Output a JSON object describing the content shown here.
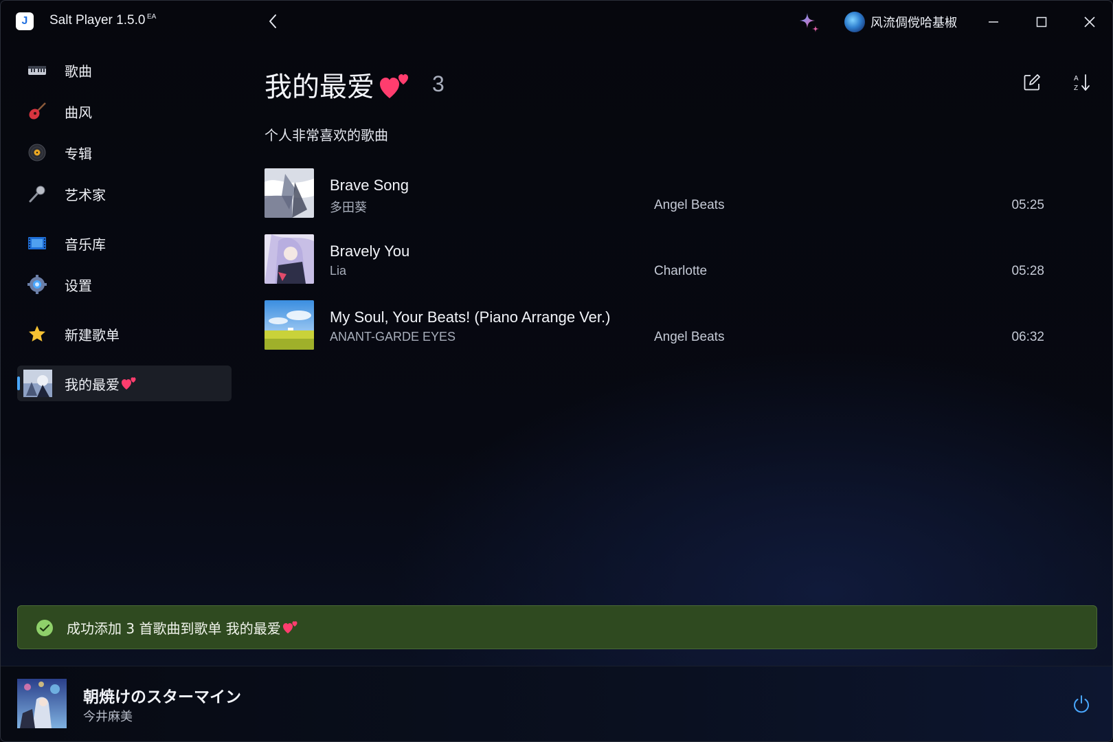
{
  "window": {
    "app_name": "Salt Player 1.5.0",
    "app_badge": "EA",
    "logo_letter": "J",
    "user_name": "风流倜傥哈基椒"
  },
  "sidebar": {
    "items": [
      {
        "label": "歌曲",
        "icon": "piano-icon"
      },
      {
        "label": "曲风",
        "icon": "guitar-icon"
      },
      {
        "label": "专辑",
        "icon": "vinyl-icon"
      },
      {
        "label": "艺术家",
        "icon": "microphone-icon"
      },
      {
        "label": "音乐库",
        "icon": "film-strip-icon"
      },
      {
        "label": "设置",
        "icon": "gear-icon"
      },
      {
        "label": "新建歌单",
        "icon": "star-icon"
      },
      {
        "label": "我的最爱",
        "icon": "playlist-cover-icon",
        "active": true
      }
    ]
  },
  "playlist": {
    "title": "我的最爱",
    "count": "3",
    "description": "个人非常喜欢的歌曲",
    "songs": [
      {
        "title": "Brave Song",
        "artist": "多田葵",
        "album": "Angel Beats",
        "duration": "05:25"
      },
      {
        "title": "Bravely You",
        "artist": "Lia",
        "album": "Charlotte",
        "duration": "05:28"
      },
      {
        "title": "My Soul, Your Beats! (Piano Arrange Ver.)",
        "artist": "ANANT-GARDE EYES",
        "album": "Angel Beats",
        "duration": "06:32"
      }
    ]
  },
  "toast": {
    "message": "成功添加 3 首歌曲到歌单 我的最爱",
    "status_color": "#2f4a20"
  },
  "now_playing": {
    "title": "朝焼けのスターマイン",
    "artist": "今井麻美"
  },
  "colors": {
    "accent": "#4aa8ff",
    "heart": "#ff3d6e",
    "success": "#8fd16a"
  }
}
